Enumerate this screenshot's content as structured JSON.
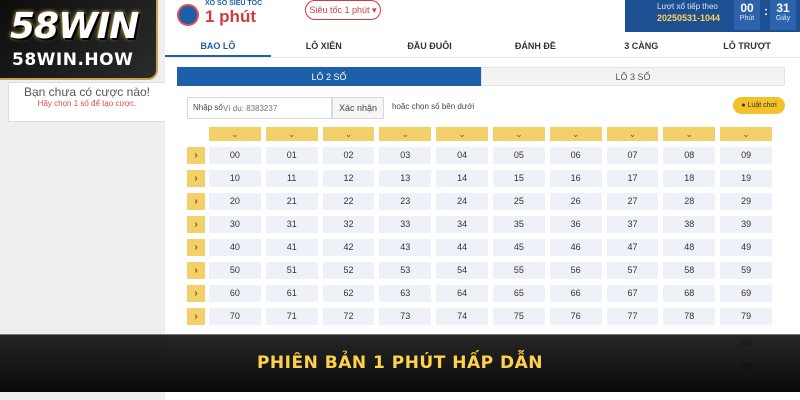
{
  "brand": {
    "logo": "58WIN",
    "site": "58WIN.HOW"
  },
  "bet_slip": {
    "title": "Bạn chưa có cược nào!",
    "hint": "Hãy chọn 1 số để tạo cược."
  },
  "header": {
    "sub": "XỔ SỐ SIÊU TỐC",
    "title": "1 phút",
    "select_value": "Siêu tốc 1 phút ▾",
    "next_label": "Lượt xổ tiếp theo",
    "next_id": "20250531-1044",
    "minutes": "00",
    "minutes_unit": "Phút",
    "seconds": "31",
    "seconds_unit": "Giây",
    "sep": ":"
  },
  "tabs": [
    "BAO LÔ",
    "LÔ XIÊN",
    "ĐẦU ĐUÔI",
    "ĐÁNH ĐỀ",
    "3 CÀNG",
    "LÔ TRƯỢT"
  ],
  "subtabs": [
    "LÔ 2 SỐ",
    "LÔ 3 SỐ"
  ],
  "input": {
    "label": "Nhập số",
    "placeholder": "Ví dụ: 8383237",
    "confirm": "Xác nhận",
    "or_text": "hoặc chọn số bên dưới",
    "rules": "● Luật chơi"
  },
  "grid": {
    "rows": [
      [
        "00",
        "01",
        "02",
        "03",
        "04",
        "05",
        "06",
        "07",
        "08",
        "09"
      ],
      [
        "10",
        "11",
        "12",
        "13",
        "14",
        "15",
        "16",
        "17",
        "18",
        "19"
      ],
      [
        "20",
        "21",
        "22",
        "23",
        "24",
        "25",
        "26",
        "27",
        "28",
        "29"
      ],
      [
        "30",
        "31",
        "32",
        "33",
        "34",
        "35",
        "36",
        "37",
        "38",
        "39"
      ],
      [
        "40",
        "41",
        "42",
        "43",
        "44",
        "45",
        "46",
        "47",
        "48",
        "49"
      ],
      [
        "50",
        "51",
        "52",
        "53",
        "54",
        "55",
        "56",
        "57",
        "58",
        "59"
      ],
      [
        "60",
        "61",
        "62",
        "63",
        "64",
        "65",
        "66",
        "67",
        "68",
        "69"
      ],
      [
        "70",
        "71",
        "72",
        "73",
        "74",
        "75",
        "76",
        "77",
        "78",
        "79"
      ]
    ],
    "peek": [
      "89",
      "99"
    ]
  },
  "banner": {
    "text": "PHIÊN BẢN 1 PHÚT HẤP DẪN"
  },
  "colors": {
    "accent": "#1d5fa8",
    "gold": "#f4d06a",
    "red": "#d23b3b"
  },
  "icons": {
    "column_select": "chevron-down-icon",
    "row_select": "chevron-right-icon"
  }
}
